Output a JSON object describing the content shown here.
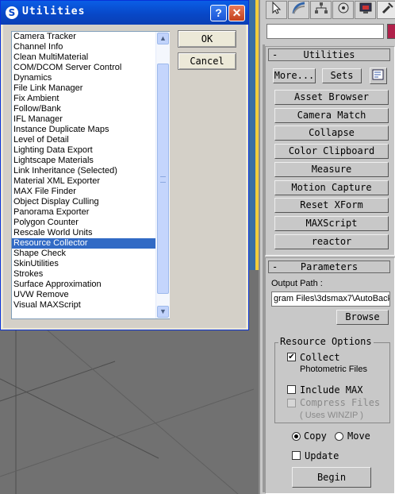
{
  "dialog": {
    "title": "Utilities",
    "help_glyph": "?",
    "close_glyph": "✕",
    "list_items": [
      "Camera Tracker",
      "Channel Info",
      "Clean MultiMaterial",
      "COM/DCOM Server Control",
      "Dynamics",
      "File Link Manager",
      "Fix Ambient",
      "Follow/Bank",
      "IFL Manager",
      "Instance Duplicate Maps",
      "Level of Detail",
      "Lighting Data Export",
      "Lightscape Materials",
      "Link Inheritance (Selected)",
      "Material XML Exporter",
      "MAX File Finder",
      "Object Display Culling",
      "Panorama Exporter",
      "Polygon Counter",
      "Rescale World Units",
      "Resource Collector",
      "Shape Check",
      "SkinUtilities",
      "Strokes",
      "Surface Approximation",
      "UVW Remove",
      "Visual MAXScript"
    ],
    "selected_index": 20,
    "ok_label": "OK",
    "cancel_label": "Cancel"
  },
  "panel": {
    "tab_icons": [
      "create-icon",
      "modify-icon",
      "hierarchy-icon",
      "motion-icon",
      "display-icon",
      "utilities-icon"
    ],
    "utilities_rollout": {
      "pm": "-",
      "title": "Utilities",
      "more_label": "More...",
      "sets_label": "Sets",
      "buttons": [
        "Asset Browser",
        "Camera Match",
        "Collapse",
        "Color Clipboard",
        "Measure",
        "Motion Capture",
        "Reset XForm",
        "MAXScript",
        "reactor"
      ]
    },
    "parameters_rollout": {
      "pm": "-",
      "title": "Parameters",
      "output_path_label": "Output Path :",
      "output_path_value": "gram Files\\3dsmax7\\AutoBack",
      "browse_label": "Browse",
      "resource_options_label": "Resource Options",
      "collect_label": "Collect",
      "collect_sub": "Photometric Files",
      "collect_checked": true,
      "include_max_label": "Include MAX",
      "include_max_checked": false,
      "compress_label": "Compress Files",
      "compress_sub": "( Uses WINZIP )",
      "compress_checked": false,
      "copy_label": "Copy",
      "move_label": "Move",
      "copy_selected": true,
      "update_label": "Update",
      "update_checked": false,
      "begin_label": "Begin"
    }
  },
  "colors": {
    "titlebar": "#0848c8",
    "selection": "#316ac5",
    "object_color": "#b0214a"
  }
}
